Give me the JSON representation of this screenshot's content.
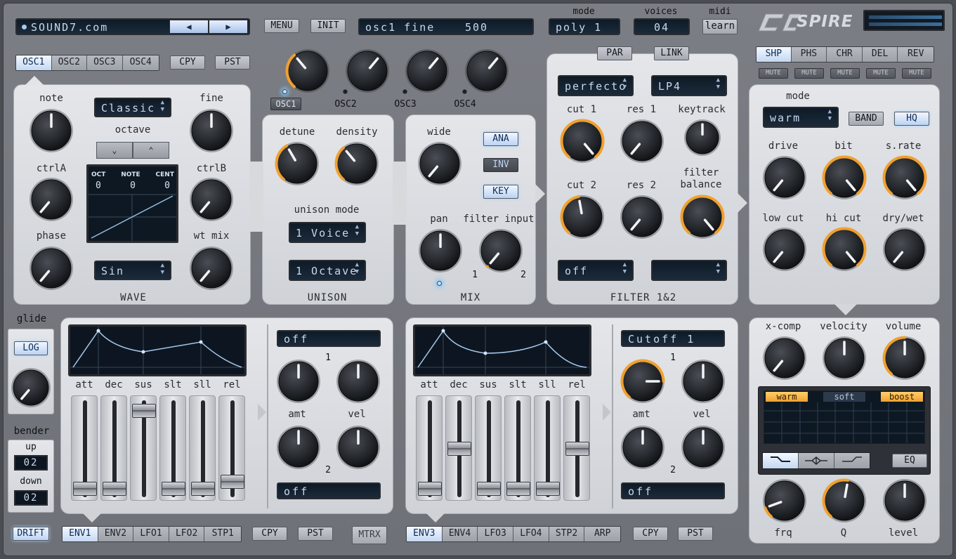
{
  "header": {
    "preset_site": "SOUND7.com",
    "menu": "MENU",
    "init": "INIT",
    "param_name": "osc1 fine",
    "param_value": "500",
    "mode_label": "mode",
    "mode_value": "poly 1",
    "voices_label": "voices",
    "voices_value": "04",
    "midi_label": "midi",
    "midi_button": "learn",
    "logo_text": "SPIRE"
  },
  "osc_tabs": [
    "OSC1",
    "OSC2",
    "OSC3",
    "OSC4"
  ],
  "osc_copy": "CPY",
  "osc_paste": "PST",
  "osc_select": [
    "OSC1",
    "OSC2",
    "OSC3",
    "OSC4"
  ],
  "wave": {
    "title": "WAVE",
    "labels": {
      "note": "note",
      "fine": "fine",
      "ctrlA": "ctrlA",
      "ctrlB": "ctrlB",
      "phase": "phase",
      "wtmix": "wt mix",
      "octave": "octave"
    },
    "mode": "Classic",
    "wave_select": "Sin",
    "display_cols": [
      "OCT",
      "NOTE",
      "CENT"
    ],
    "display_vals": [
      "0",
      "0",
      "0"
    ]
  },
  "unison": {
    "title": "UNISON",
    "detune": "detune",
    "density": "density",
    "mode_label": "unison mode",
    "voice": "1 Voice",
    "octave": "1 Octave"
  },
  "mix": {
    "title": "MIX",
    "wide": "wide",
    "pan": "pan",
    "filter_input": "filter input",
    "fi_1": "1",
    "fi_2": "2",
    "ana": "ANA",
    "inv": "INV",
    "key": "KEY"
  },
  "filter": {
    "title": "FILTER 1&2",
    "par": "PAR",
    "link": "LINK",
    "type1": "perfecto",
    "type2": "LP4",
    "cut1": "cut 1",
    "res1": "res 1",
    "keytrack": "keytrack",
    "cut2": "cut 2",
    "res2": "res 2",
    "balance": "filter balance",
    "mod1": "off",
    "mod2": ""
  },
  "fx": {
    "tabs": [
      "SHP",
      "PHS",
      "CHR",
      "DEL",
      "REV"
    ],
    "mute": "MUTE",
    "mode_label": "mode",
    "mode_value": "warm",
    "band": "BAND",
    "hq": "HQ",
    "drive": "drive",
    "bit": "bit",
    "srate": "s.rate",
    "lowcut": "low cut",
    "hicut": "hi cut",
    "drywet": "dry/wet"
  },
  "eq": {
    "xcomp": "x-comp",
    "velocity": "velocity",
    "volume": "volume",
    "modes": [
      "warm",
      "soft",
      "boost"
    ],
    "eq_button": "EQ",
    "frq": "frq",
    "q": "Q",
    "level": "level"
  },
  "left": {
    "glide": "glide",
    "log": "LOG",
    "bender": "bender",
    "up": "up",
    "up_value": "02",
    "down": "down",
    "down_value": "02",
    "drift": "DRIFT",
    "mtrx": "MTRX"
  },
  "env_left": {
    "tabs": [
      "ENV1",
      "ENV2",
      "LFO1",
      "LFO2",
      "STP1"
    ],
    "copy": "CPY",
    "paste": "PST",
    "faders": [
      "att",
      "dec",
      "sus",
      "slt",
      "sll",
      "rel"
    ],
    "fader_levels": [
      0.02,
      0.02,
      0.96,
      0.02,
      0.02,
      0.1
    ],
    "dest1": "off",
    "dest2": "off",
    "amt": "amt",
    "vel": "vel",
    "n1": "1",
    "n2": "2"
  },
  "env_right": {
    "tabs": [
      "ENV3",
      "ENV4",
      "LFO3",
      "LFO4",
      "STP2",
      "ARP"
    ],
    "copy": "CPY",
    "paste": "PST",
    "faders": [
      "att",
      "dec",
      "sus",
      "slt",
      "sll",
      "rel"
    ],
    "fader_levels": [
      0.02,
      0.5,
      0.02,
      0.02,
      0.02,
      0.5
    ],
    "dest1": "Cutoff 1",
    "dest2": "off",
    "amt": "amt",
    "vel": "vel",
    "n1": "1",
    "n2": "2"
  },
  "colors": {
    "accent": "#f0a030",
    "lcd_bg": "#0f1b28",
    "lcd_text": "#c9d9ee",
    "panel": "#dcdee2",
    "frame": "#75787e",
    "tab_on": "#cfe0f5"
  }
}
